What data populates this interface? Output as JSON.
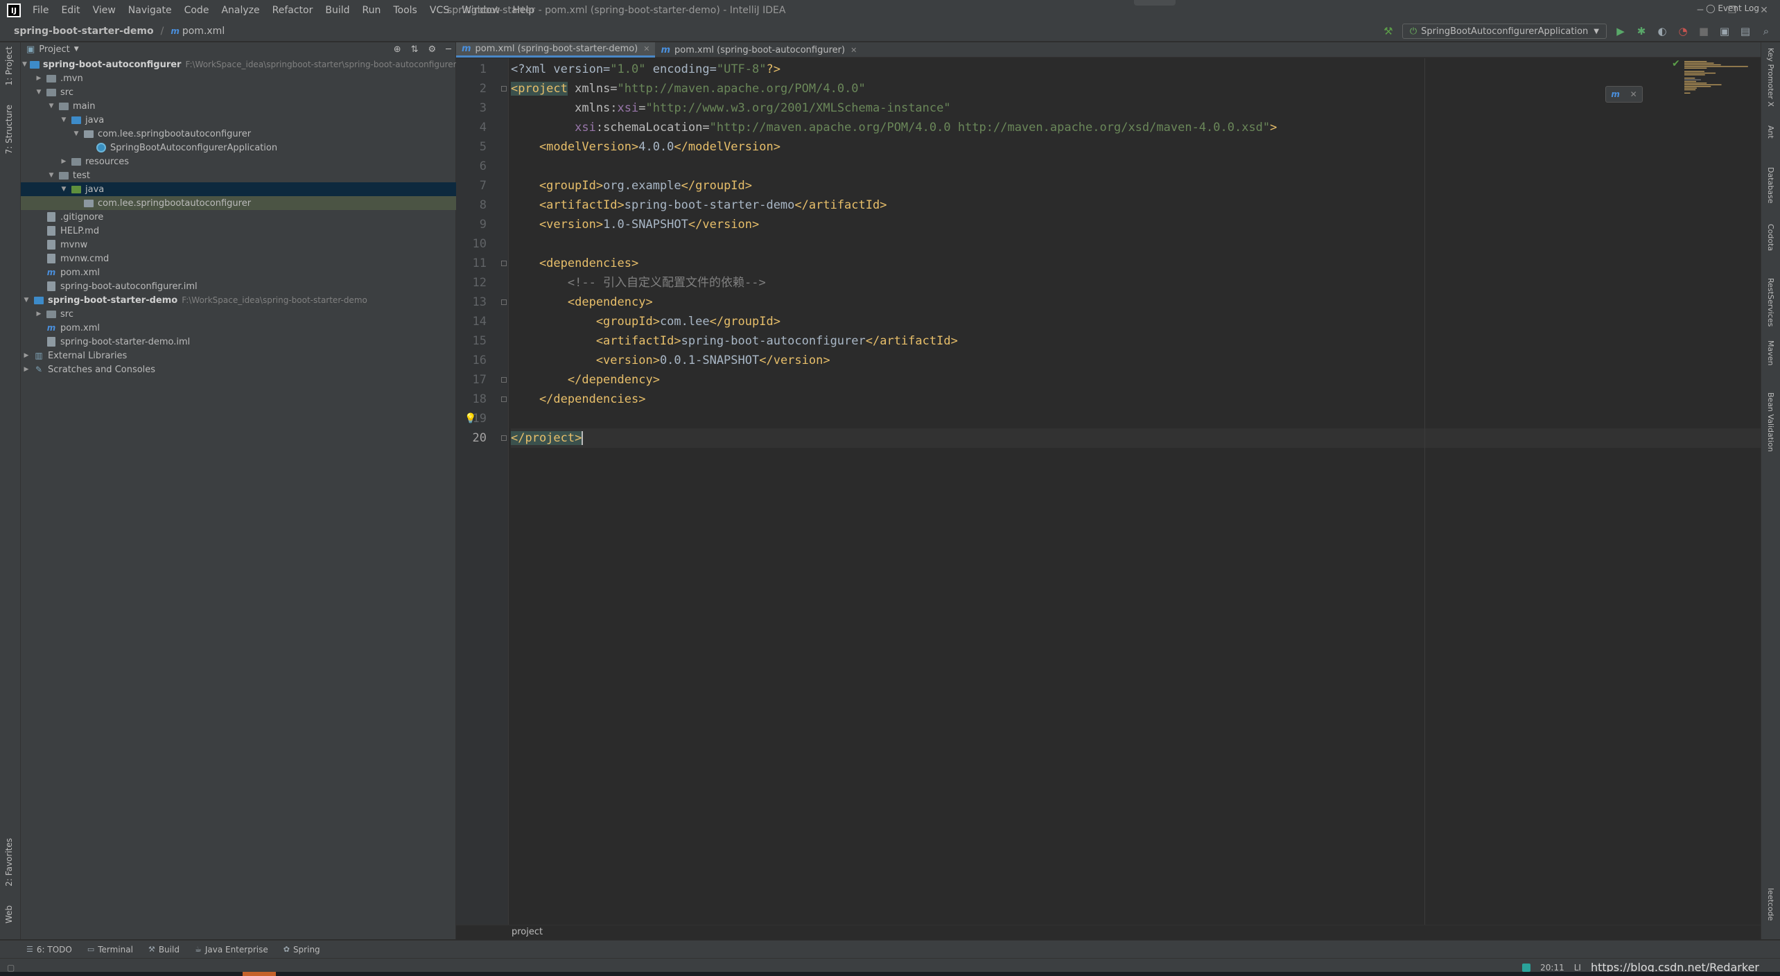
{
  "window": {
    "title": "springboot-starter - pom.xml (spring-boot-starter-demo) - IntelliJ IDEA",
    "logo": "IJ",
    "controls": [
      "─",
      "❐",
      "✕"
    ]
  },
  "menu": [
    "File",
    "Edit",
    "View",
    "Navigate",
    "Code",
    "Analyze",
    "Refactor",
    "Build",
    "Run",
    "Tools",
    "VCS",
    "Window",
    "Help"
  ],
  "navbar": {
    "breadcrumb": [
      "spring-boot-starter-demo",
      "pom.xml"
    ],
    "run_config": "SpringBootAutoconfigurerApplication"
  },
  "left_stripe": {
    "tabs": [
      "1: Project",
      "7: Structure",
      "2: Favorites",
      "Web"
    ]
  },
  "project_panel": {
    "title": "Project",
    "tree": [
      {
        "depth": 0,
        "arrow": "▼",
        "icon": "module-folder",
        "label": "spring-boot-autoconfigurer",
        "bold": true,
        "path": "F:\\WorkSpace_idea\\springboot-starter\\spring-boot-autoconfigurer"
      },
      {
        "depth": 1,
        "arrow": "▶",
        "icon": "folder",
        "label": ".mvn"
      },
      {
        "depth": 1,
        "arrow": "▼",
        "icon": "folder",
        "label": "src"
      },
      {
        "depth": 2,
        "arrow": "▼",
        "icon": "folder",
        "label": "main"
      },
      {
        "depth": 3,
        "arrow": "▼",
        "icon": "source-folder",
        "label": "java"
      },
      {
        "depth": 4,
        "arrow": "▼",
        "icon": "package",
        "label": "com.lee.springbootautoconfigurer"
      },
      {
        "depth": 5,
        "arrow": "",
        "icon": "class",
        "label": "SpringBootAutoconfigurerApplication"
      },
      {
        "depth": 3,
        "arrow": "▶",
        "icon": "folder",
        "label": "resources"
      },
      {
        "depth": 2,
        "arrow": "▼",
        "icon": "folder",
        "label": "test"
      },
      {
        "depth": 3,
        "arrow": "▼",
        "icon": "test-folder",
        "label": "java",
        "state": "selected"
      },
      {
        "depth": 4,
        "arrow": "",
        "icon": "package",
        "label": "com.lee.springbootautoconfigurer",
        "state": "highlight"
      },
      {
        "depth": 1,
        "arrow": "",
        "icon": "file",
        "label": ".gitignore"
      },
      {
        "depth": 1,
        "arrow": "",
        "icon": "file",
        "label": "HELP.md"
      },
      {
        "depth": 1,
        "arrow": "",
        "icon": "file",
        "label": "mvnw"
      },
      {
        "depth": 1,
        "arrow": "",
        "icon": "file",
        "label": "mvnw.cmd"
      },
      {
        "depth": 1,
        "arrow": "",
        "icon": "maven",
        "label": "pom.xml"
      },
      {
        "depth": 1,
        "arrow": "",
        "icon": "file",
        "label": "spring-boot-autoconfigurer.iml"
      },
      {
        "depth": 0,
        "arrow": "▼",
        "icon": "module-folder",
        "label": "spring-boot-starter-demo",
        "bold": true,
        "path": "F:\\WorkSpace_idea\\spring-boot-starter-demo"
      },
      {
        "depth": 1,
        "arrow": "▶",
        "icon": "folder",
        "label": "src"
      },
      {
        "depth": 1,
        "arrow": "",
        "icon": "maven",
        "label": "pom.xml"
      },
      {
        "depth": 1,
        "arrow": "",
        "icon": "file",
        "label": "spring-boot-starter-demo.iml"
      },
      {
        "depth": 0,
        "arrow": "▶",
        "icon": "library",
        "label": "External Libraries"
      },
      {
        "depth": 0,
        "arrow": "▶",
        "icon": "scratch",
        "label": "Scratches and Consoles"
      }
    ]
  },
  "editor_tabs": [
    {
      "label": "pom.xml (spring-boot-starter-demo)",
      "active": true
    },
    {
      "label": "pom.xml (spring-boot-autoconfigurer)",
      "active": false
    }
  ],
  "editor": {
    "current_line": 20,
    "lines": [
      [
        [
          "t",
          "<?xml version="
        ],
        [
          "s",
          "\"1.0\""
        ],
        [
          "t",
          " encoding="
        ],
        [
          "s",
          "\"UTF-8\""
        ],
        [
          "k",
          "?>"
        ]
      ],
      [
        [
          "k-hl",
          "<project"
        ],
        [
          "a",
          " xmlns="
        ],
        [
          "s",
          "\"http://maven.apache.org/POM/4.0.0\""
        ]
      ],
      [
        [
          "a",
          "         xmlns:"
        ],
        [
          "ns",
          "xsi"
        ],
        [
          "a",
          "="
        ],
        [
          "s",
          "\"http://www.w3.org/2001/XMLSchema-instance\""
        ]
      ],
      [
        [
          "ns",
          "         xsi"
        ],
        [
          "a",
          ":schemaLocation="
        ],
        [
          "s",
          "\"http://maven.apache.org/POM/4.0.0 http://maven.apache.org/xsd/maven-4.0.0.xsd\""
        ],
        [
          "k",
          ">"
        ]
      ],
      [
        [
          "k",
          "    <modelVersion>"
        ],
        [
          "t",
          "4.0.0"
        ],
        [
          "k",
          "</modelVersion>"
        ]
      ],
      [],
      [
        [
          "k",
          "    <groupId>"
        ],
        [
          "t",
          "org.example"
        ],
        [
          "k",
          "</groupId>"
        ]
      ],
      [
        [
          "k",
          "    <artifactId>"
        ],
        [
          "t",
          "spring-boot-starter-demo"
        ],
        [
          "k",
          "</artifactId>"
        ]
      ],
      [
        [
          "k",
          "    <version>"
        ],
        [
          "t",
          "1.0-SNAPSHOT"
        ],
        [
          "k",
          "</version>"
        ]
      ],
      [],
      [
        [
          "k",
          "    <dependencies>"
        ]
      ],
      [
        [
          "c",
          "        <!-- 引入自定义配置文件的依赖-->"
        ]
      ],
      [
        [
          "k",
          "        <dependency>"
        ]
      ],
      [
        [
          "k",
          "            <groupId>"
        ],
        [
          "t",
          "com.lee"
        ],
        [
          "k",
          "</groupId>"
        ]
      ],
      [
        [
          "k",
          "            <artifactId>"
        ],
        [
          "t",
          "spring-boot-autoconfigurer"
        ],
        [
          "k",
          "</artifactId>"
        ]
      ],
      [
        [
          "k",
          "            <version>"
        ],
        [
          "t",
          "0.0.1-SNAPSHOT"
        ],
        [
          "k",
          "</version>"
        ]
      ],
      [
        [
          "k",
          "        </dependency>"
        ]
      ],
      [
        [
          "k",
          "    </dependencies>"
        ]
      ],
      [],
      [
        [
          "k-hl",
          "</project>"
        ]
      ]
    ],
    "fold_lines": [
      2,
      11,
      13,
      17,
      18,
      20
    ],
    "status_crumb": "project"
  },
  "right_stripe": {
    "tabs": [
      "Key Promoter X",
      "Ant",
      "Database",
      "Codota",
      "RestServices",
      "Maven",
      "Bean Validation",
      "leetcode"
    ]
  },
  "bottom_tools": [
    {
      "icon": "☰",
      "label": "6: TODO"
    },
    {
      "icon": "▭",
      "label": "Terminal"
    },
    {
      "icon": "⚒",
      "label": "Build"
    },
    {
      "icon": "☕",
      "label": "Java Enterprise"
    },
    {
      "icon": "✿",
      "label": "Spring"
    }
  ],
  "event_log": "Event Log",
  "statusbar": {
    "position": "20:11",
    "encoding_fragment": "LI",
    "watermark": "https://blog.csdn.net/Redarker"
  },
  "colors": {
    "chrome": "#3c3f41",
    "editor_bg": "#2b2b2b",
    "xml_tag": "#e8bf6a",
    "xml_string": "#6a8759",
    "comment": "#808080",
    "accent": "#4a88c7"
  }
}
